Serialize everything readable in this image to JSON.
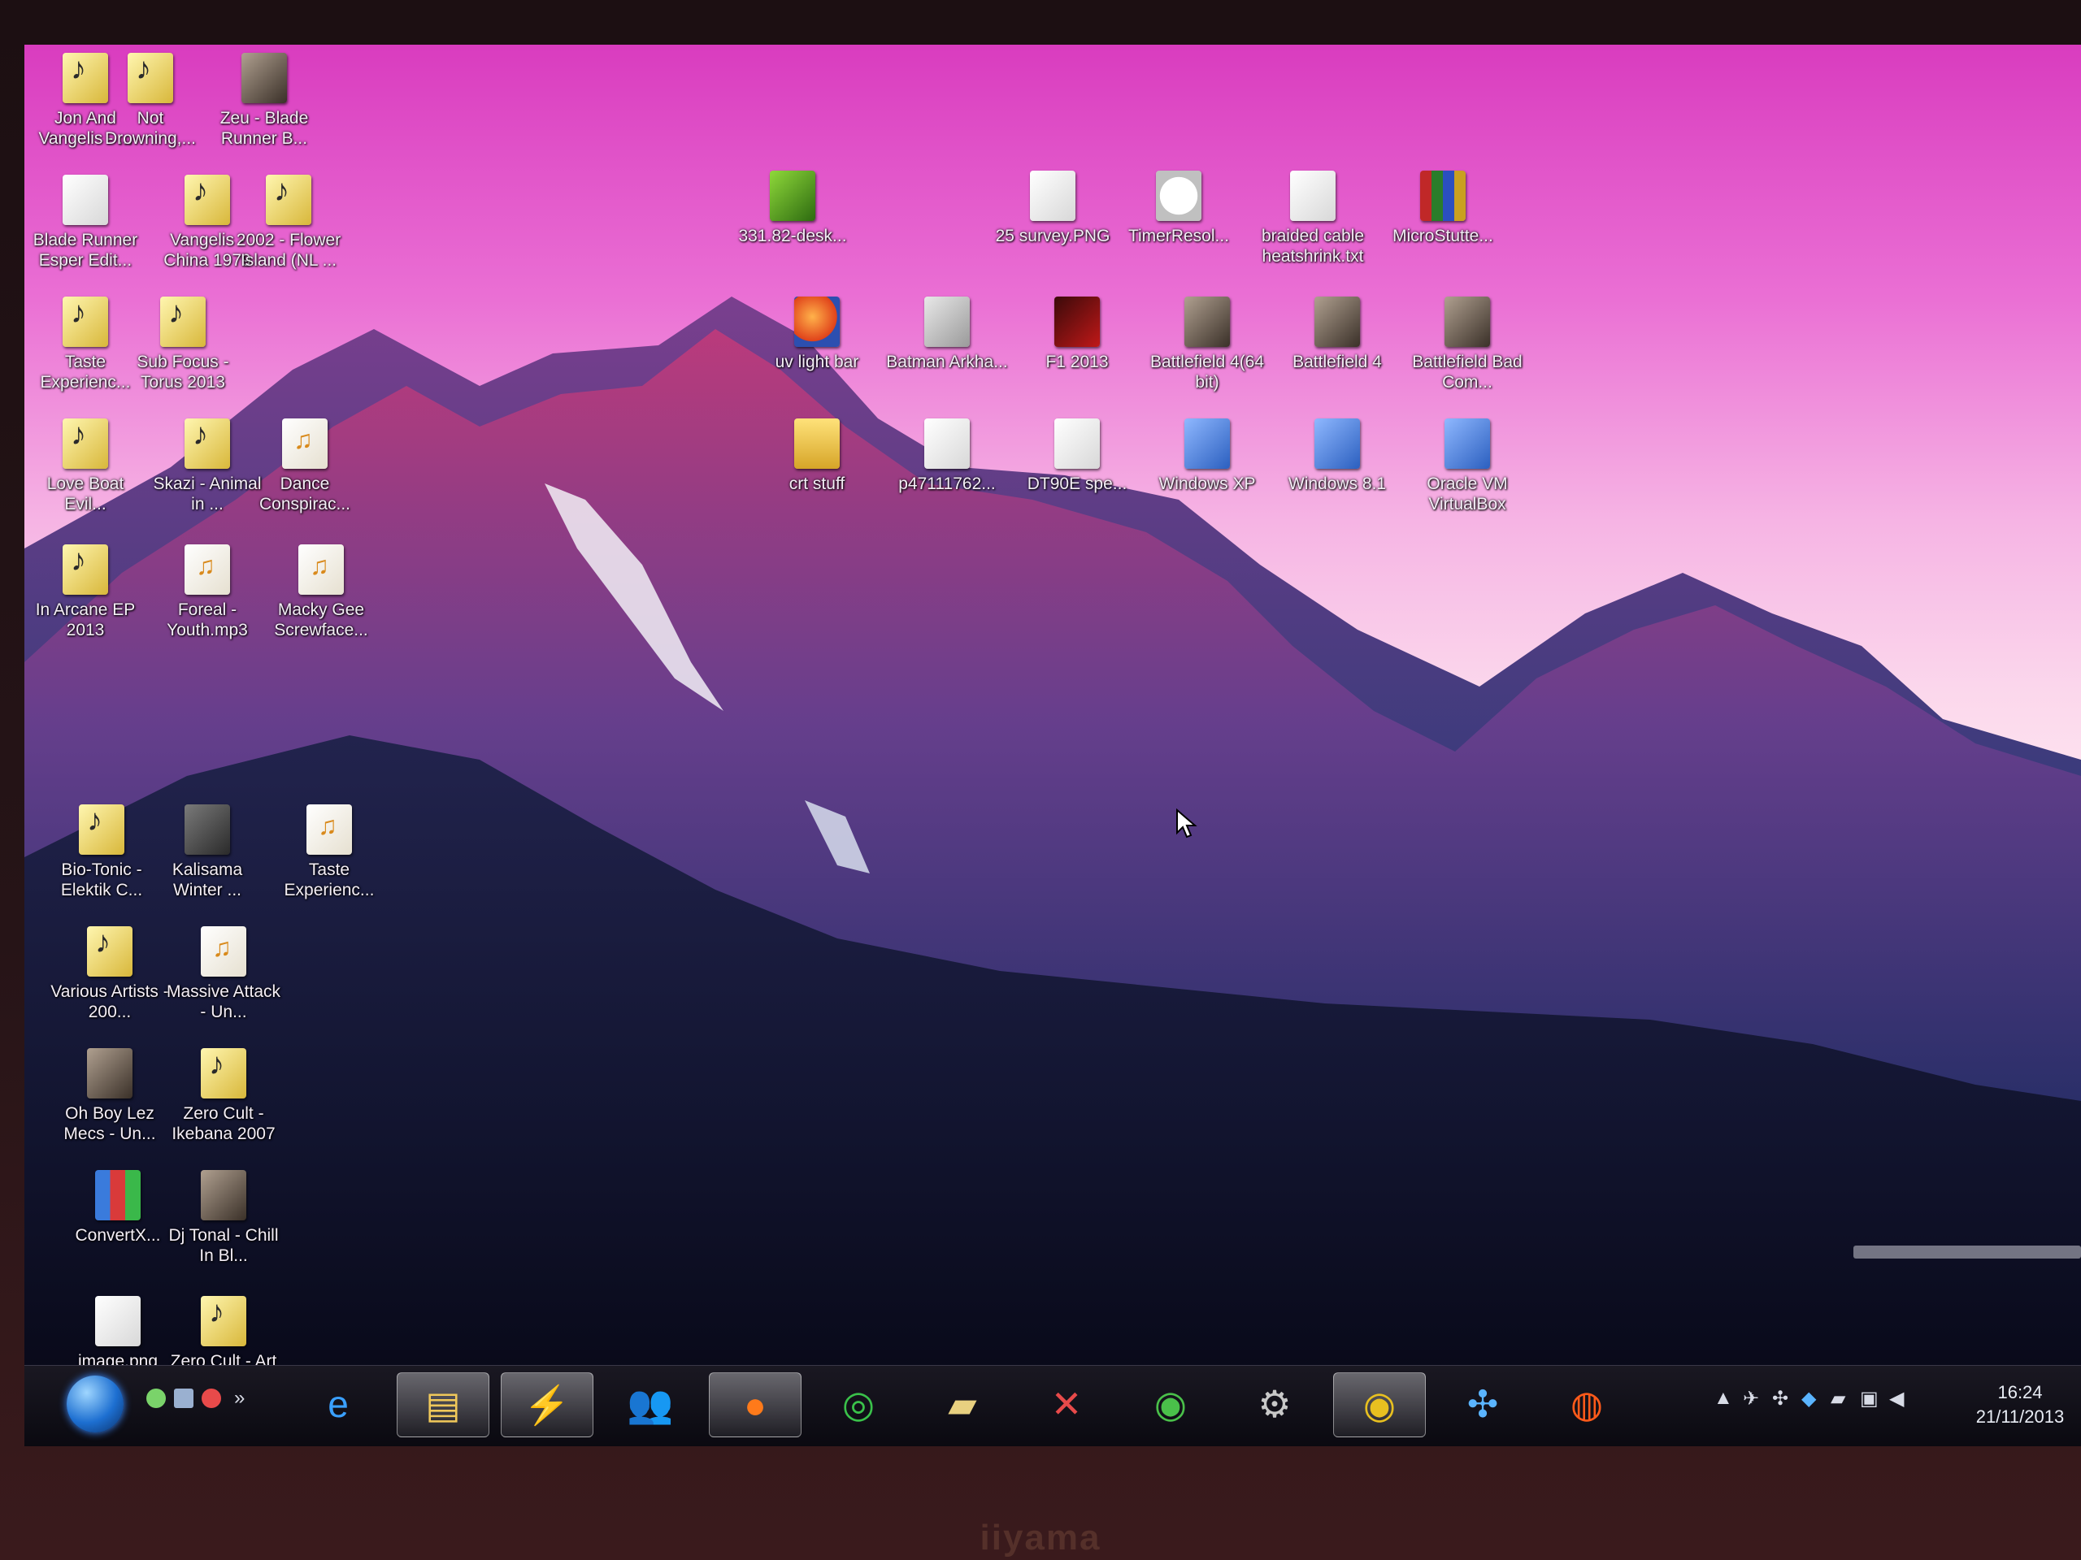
{
  "monitor": {
    "brand": "iiyama"
  },
  "desktop": {
    "icons": [
      {
        "label": "Jon And Vangelis - ...",
        "type": "music"
      },
      {
        "label": "Not Drowning,...",
        "type": "music"
      },
      {
        "label": "Zeu - Blade Runner B...",
        "type": "game"
      },
      {
        "label": "Blade Runner Esper Edit...",
        "type": "file"
      },
      {
        "label": "Vangelis - China 1979",
        "type": "music"
      },
      {
        "label": "2002 - Flower Island (NL ...",
        "type": "music"
      },
      {
        "label": "Taste Experienc...",
        "type": "music"
      },
      {
        "label": "Sub Focus - Torus 2013",
        "type": "music"
      },
      {
        "label": "Love Boat Evil...",
        "type": "music"
      },
      {
        "label": "Skazi - Animal in ...",
        "type": "music"
      },
      {
        "label": "Dance Conspirac...",
        "type": "mp3"
      },
      {
        "label": "In Arcane EP 2013",
        "type": "music"
      },
      {
        "label": "Foreal - Youth.mp3",
        "type": "mp3"
      },
      {
        "label": "Macky Gee Screwface...",
        "type": "mp3"
      },
      {
        "label": "Bio-Tonic - Elektik C...",
        "type": "music"
      },
      {
        "label": "Kalisama Winter ...",
        "type": "app"
      },
      {
        "label": "Taste Experienc...",
        "type": "mp3"
      },
      {
        "label": "Various Artists - 200...",
        "type": "music"
      },
      {
        "label": "Massive Attack - Un...",
        "type": "mp3"
      },
      {
        "label": "Oh Boy Lez Mecs - Un...",
        "type": "game"
      },
      {
        "label": "Zero Cult - Ikebana 2007",
        "type": "music"
      },
      {
        "label": "ConvertX...",
        "type": "conv"
      },
      {
        "label": "Dj Tonal - Chill In Bl...",
        "type": "game"
      },
      {
        "label": "image.png",
        "type": "file"
      },
      {
        "label": "Zero Cult - Art Of H...",
        "type": "music"
      },
      {
        "label": "331.82-desk...",
        "type": "green"
      },
      {
        "label": "25 survey.PNG",
        "type": "file"
      },
      {
        "label": "TimerResol...",
        "type": "clock"
      },
      {
        "label": "braided cable heatshrink.txt",
        "type": "file"
      },
      {
        "label": "MicroStutte...",
        "type": "rar"
      },
      {
        "label": "uv light bar",
        "type": "firefox"
      },
      {
        "label": "Batman Arkha...",
        "type": "bat"
      },
      {
        "label": "F1 2013",
        "type": "f1"
      },
      {
        "label": "Battlefield 4(64 bit)",
        "type": "game"
      },
      {
        "label": "Battlefield 4",
        "type": "game"
      },
      {
        "label": "Battlefield Bad Com...",
        "type": "game"
      },
      {
        "label": "crt stuff",
        "type": "folder"
      },
      {
        "label": "p47111762...",
        "type": "file"
      },
      {
        "label": "DT90E spe...",
        "type": "file"
      },
      {
        "label": "Windows XP",
        "type": "box"
      },
      {
        "label": "Windows 8.1",
        "type": "box"
      },
      {
        "label": "Oracle VM VirtualBox",
        "type": "box"
      }
    ]
  },
  "taskbar": {
    "start": "windows-orb",
    "pinned": [
      {
        "name": "internet-explorer",
        "glyph": "e",
        "color": "#3aa0ff"
      },
      {
        "name": "file-explorer",
        "glyph": "▤",
        "color": "#f0c85a"
      },
      {
        "name": "winamp",
        "glyph": "⚡",
        "color": "#ffcc33"
      },
      {
        "name": "messenger",
        "glyph": "👥",
        "color": "#6acb4a"
      },
      {
        "name": "firefox",
        "glyph": "●",
        "color": "#ff7a1a"
      },
      {
        "name": "ccleaner",
        "glyph": "◎",
        "color": "#3ac14a"
      },
      {
        "name": "scanner",
        "glyph": "▰",
        "color": "#e8d080"
      },
      {
        "name": "tools",
        "glyph": "✕",
        "color": "#e84a4a"
      },
      {
        "name": "globe",
        "glyph": "◉",
        "color": "#4ac04a"
      },
      {
        "name": "steam",
        "glyph": "⚙",
        "color": "#c8c8c8"
      },
      {
        "name": "chrome",
        "glyph": "◉",
        "color": "#e8c020"
      },
      {
        "name": "network",
        "glyph": "✣",
        "color": "#5ab4ff"
      },
      {
        "name": "origin",
        "glyph": "◍",
        "color": "#ff5a1a"
      }
    ],
    "clock": {
      "time": "16:24",
      "date": "21/11/2013"
    }
  }
}
